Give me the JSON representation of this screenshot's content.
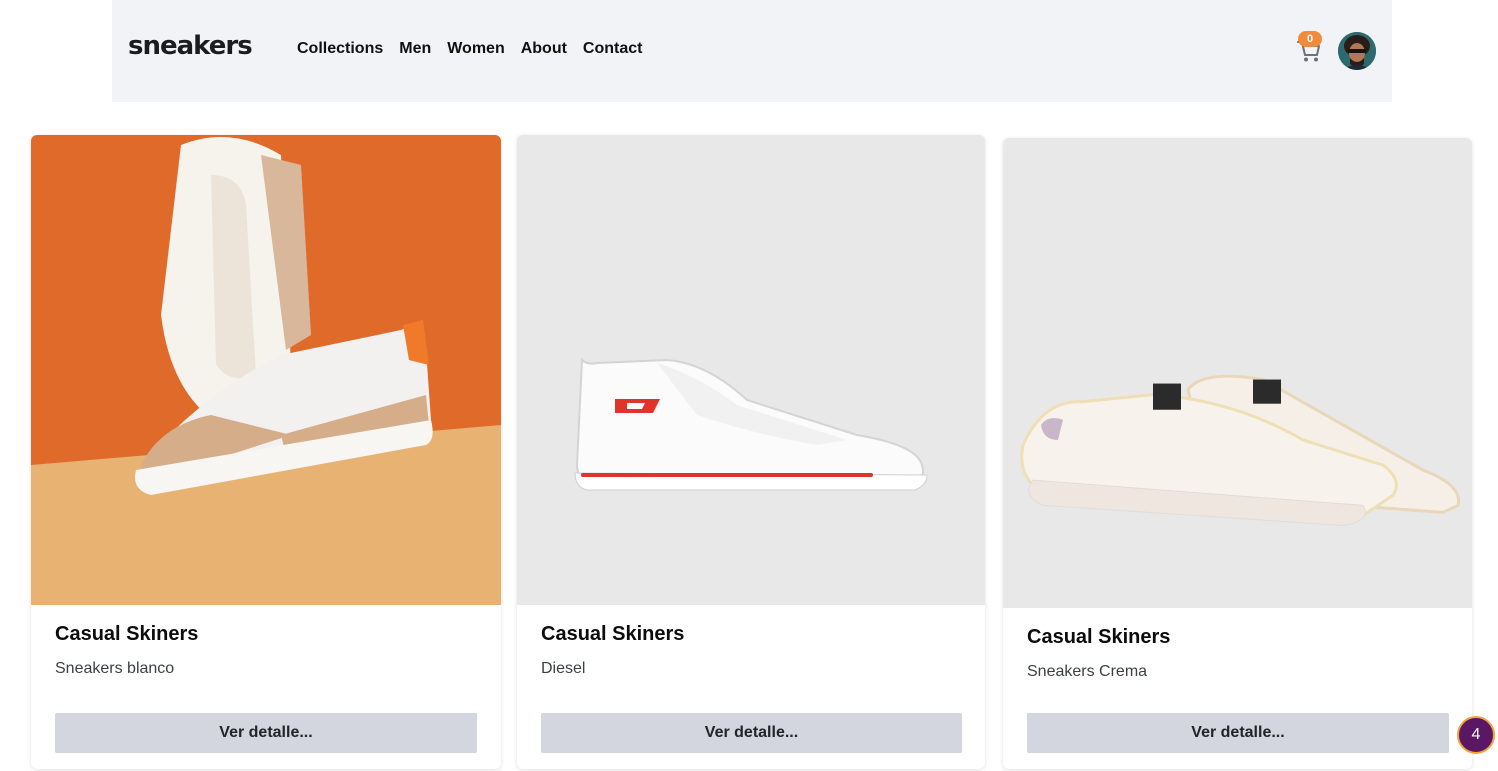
{
  "header": {
    "logo": "sneakers",
    "nav": [
      "Collections",
      "Men",
      "Women",
      "About",
      "Contact"
    ],
    "cart_count": "0"
  },
  "products": [
    {
      "title": "Casual Skiners",
      "subtitle": "Sneakers blanco",
      "button": "Ver detalle...",
      "image_bg": "#e06a2a",
      "image_floor": "#e8b273"
    },
    {
      "title": "Casual Skiners",
      "subtitle": "Diesel",
      "button": "Ver detalle...",
      "image_bg": "#e8e8e8"
    },
    {
      "title": "Casual Skiners",
      "subtitle": "Sneakers Crema",
      "button": "Ver detalle...",
      "image_bg": "#e8e8e8"
    }
  ],
  "fab": {
    "label": "4"
  },
  "colors": {
    "accent": "#f08a3d",
    "fab": "#5b1763",
    "header_bg": "#f1f3f7",
    "button_bg": "#d3d6de"
  }
}
